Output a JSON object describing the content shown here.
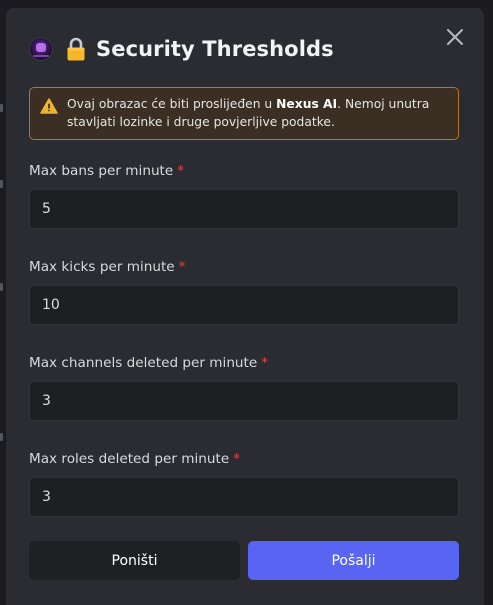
{
  "modal": {
    "title": "Security Thresholds",
    "title_emoji": "lock",
    "bot_avatar_icon": "bot-avatar"
  },
  "warning": {
    "text_before": "Ovaj obrazac će biti proslijeđen u ",
    "app_name": "Nexus AI",
    "text_after": ". Nemoj unutra stavljati lozinke i druge povjerljive podatke.",
    "icon": "warning-triangle-icon",
    "colors": {
      "border": "#b5762a",
      "background": "#3a2f22",
      "icon": "#f0b232"
    }
  },
  "fields": [
    {
      "label": "Max bans per minute",
      "required_mark": "*",
      "value": "5"
    },
    {
      "label": "Max kicks per minute",
      "required_mark": "*",
      "value": "10"
    },
    {
      "label": "Max channels deleted per minute",
      "required_mark": "*",
      "value": "3"
    },
    {
      "label": "Max roles deleted per minute",
      "required_mark": "*",
      "value": "3"
    }
  ],
  "buttons": {
    "cancel_label": "Poništi",
    "submit_label": "Pošalji"
  },
  "colors": {
    "accent": "#5865f2",
    "required": "#f23f43",
    "modal_bg": "#2b2c31",
    "input_bg": "#1e1f22"
  }
}
